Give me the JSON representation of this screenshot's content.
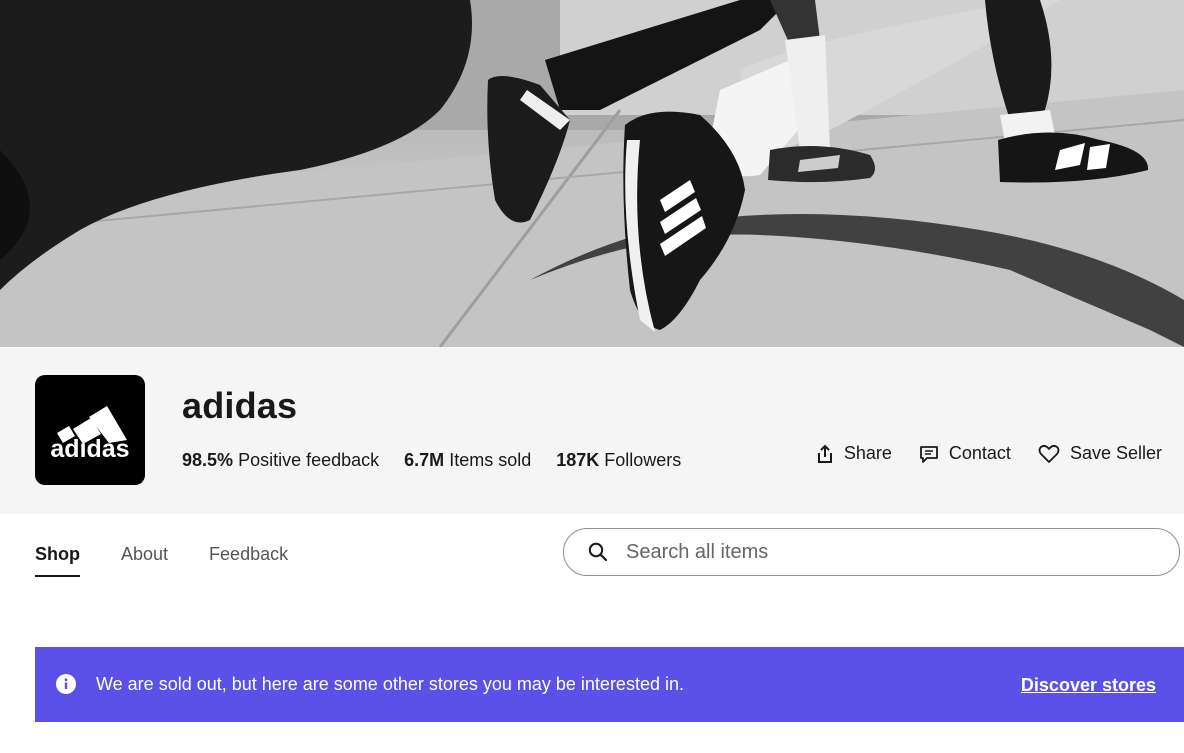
{
  "banner": {
    "shoe_logo_text": "adidas"
  },
  "seller": {
    "logo_wordmark": "adidas",
    "name": "adidas",
    "stats": [
      {
        "value": "98.5%",
        "label": "Positive feedback"
      },
      {
        "value": "6.7M",
        "label": "Items sold"
      },
      {
        "value": "187K",
        "label": "Followers"
      }
    ]
  },
  "actions": {
    "share": "Share",
    "contact": "Contact",
    "save_seller": "Save Seller"
  },
  "tabs": [
    {
      "label": "Shop",
      "active": true
    },
    {
      "label": "About",
      "active": false
    },
    {
      "label": "Feedback",
      "active": false
    }
  ],
  "search": {
    "placeholder": "Search all items",
    "value": ""
  },
  "notice": {
    "text": "We are sold out, but here are some other stores you may be interested in.",
    "link": "Discover stores",
    "background": "#5b50e8"
  },
  "icons": {
    "search": "search-icon",
    "share": "share-icon",
    "contact": "message-icon",
    "save": "heart-icon",
    "info": "info-icon"
  }
}
